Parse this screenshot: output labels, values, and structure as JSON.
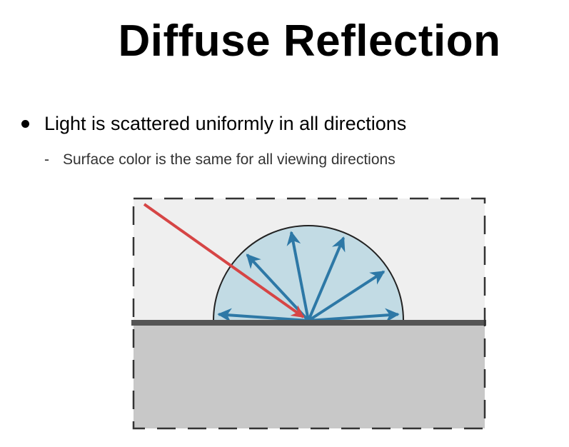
{
  "slide": {
    "title": "Diffuse Reflection",
    "bullet": "Light is scattered uniformly in all directions",
    "sub_bullet_marker": "-",
    "sub_bullet": "Surface color is the same for all viewing directions"
  },
  "diagram": {
    "colors": {
      "upper_fill": "#efefef",
      "lower_fill": "#c8c8c8",
      "hemisphere_fill": "#c2dbe4",
      "reflected_arrow": "#2d78a6",
      "incident_arrow": "#d64545",
      "surface_line": "#555555",
      "border": "#333333"
    },
    "reflected_ray_angles_deg": [
      176,
      133,
      101,
      67,
      33,
      4
    ],
    "icon_names": [
      "reflected-ray-arrow",
      "incident-ray-arrow"
    ]
  }
}
